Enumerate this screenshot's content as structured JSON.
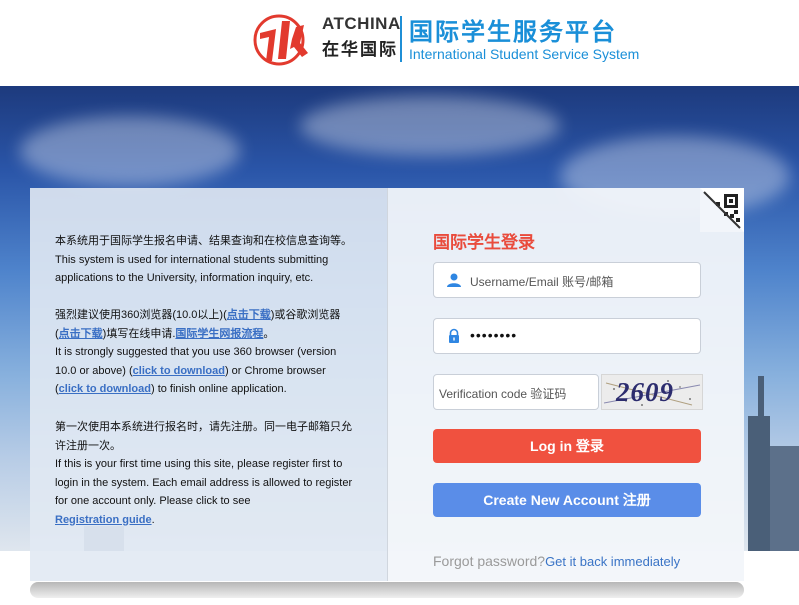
{
  "header": {
    "brand_en": "ATCHINA",
    "brand_cn": "在华国际",
    "system_cn": "国际学生服务平台",
    "system_en": "International Student Service System",
    "accent_color": "#1a8fd8"
  },
  "info": {
    "para1_cn": "本系统用于国际学生报名申请、结果查询和在校信息查询等。",
    "para1_en": "This system is used for international students submitting applications to the University, information inquiry, etc.",
    "para2_cn_a": "强烈建议使用360浏览器(10.0以上)(",
    "para2_cn_link1": "点击下载",
    "para2_cn_b": ")或谷歌浏览器(",
    "para2_cn_link2": "点击下载",
    "para2_cn_c": ")填写在线申请.",
    "para2_cn_link3": "国际学生网报流程",
    "para2_cn_d": "。",
    "para2_en_a": "It is strongly suggested that you use 360 browser (version 10.0 or above) (",
    "para2_en_link1": "click to download",
    "para2_en_b": ") or Chrome browser (",
    "para2_en_link2": "click to download",
    "para2_en_c": ") to finish online application.",
    "para3_cn": "第一次使用本系统进行报名时，请先注册。同一电子邮箱只允许注册一次。",
    "para3_en": "If this is your first time using this site, please register first to login in the system. Each email address is allowed to register for one account only. Please click to see",
    "para3_link": "Registration guide",
    "para3_end": "."
  },
  "login": {
    "title": "国际学生登录",
    "username_placeholder": "Username/Email 账号/邮箱",
    "password_value": "••••••••",
    "verification_placeholder": "Verification code 验证码",
    "captcha_text": "2609",
    "login_button": "Log in 登录",
    "create_button": "Create New Account 注册",
    "forgot_text": "Forgot password?",
    "forgot_link": "Get it back immediately",
    "login_color": "#f0513f",
    "create_color": "#5a8de8",
    "title_color": "#e94b3c"
  },
  "icons": {
    "logo": "atchina-logo-icon",
    "user": "user-icon",
    "lock": "lock-icon",
    "qr": "qr-code-icon"
  }
}
